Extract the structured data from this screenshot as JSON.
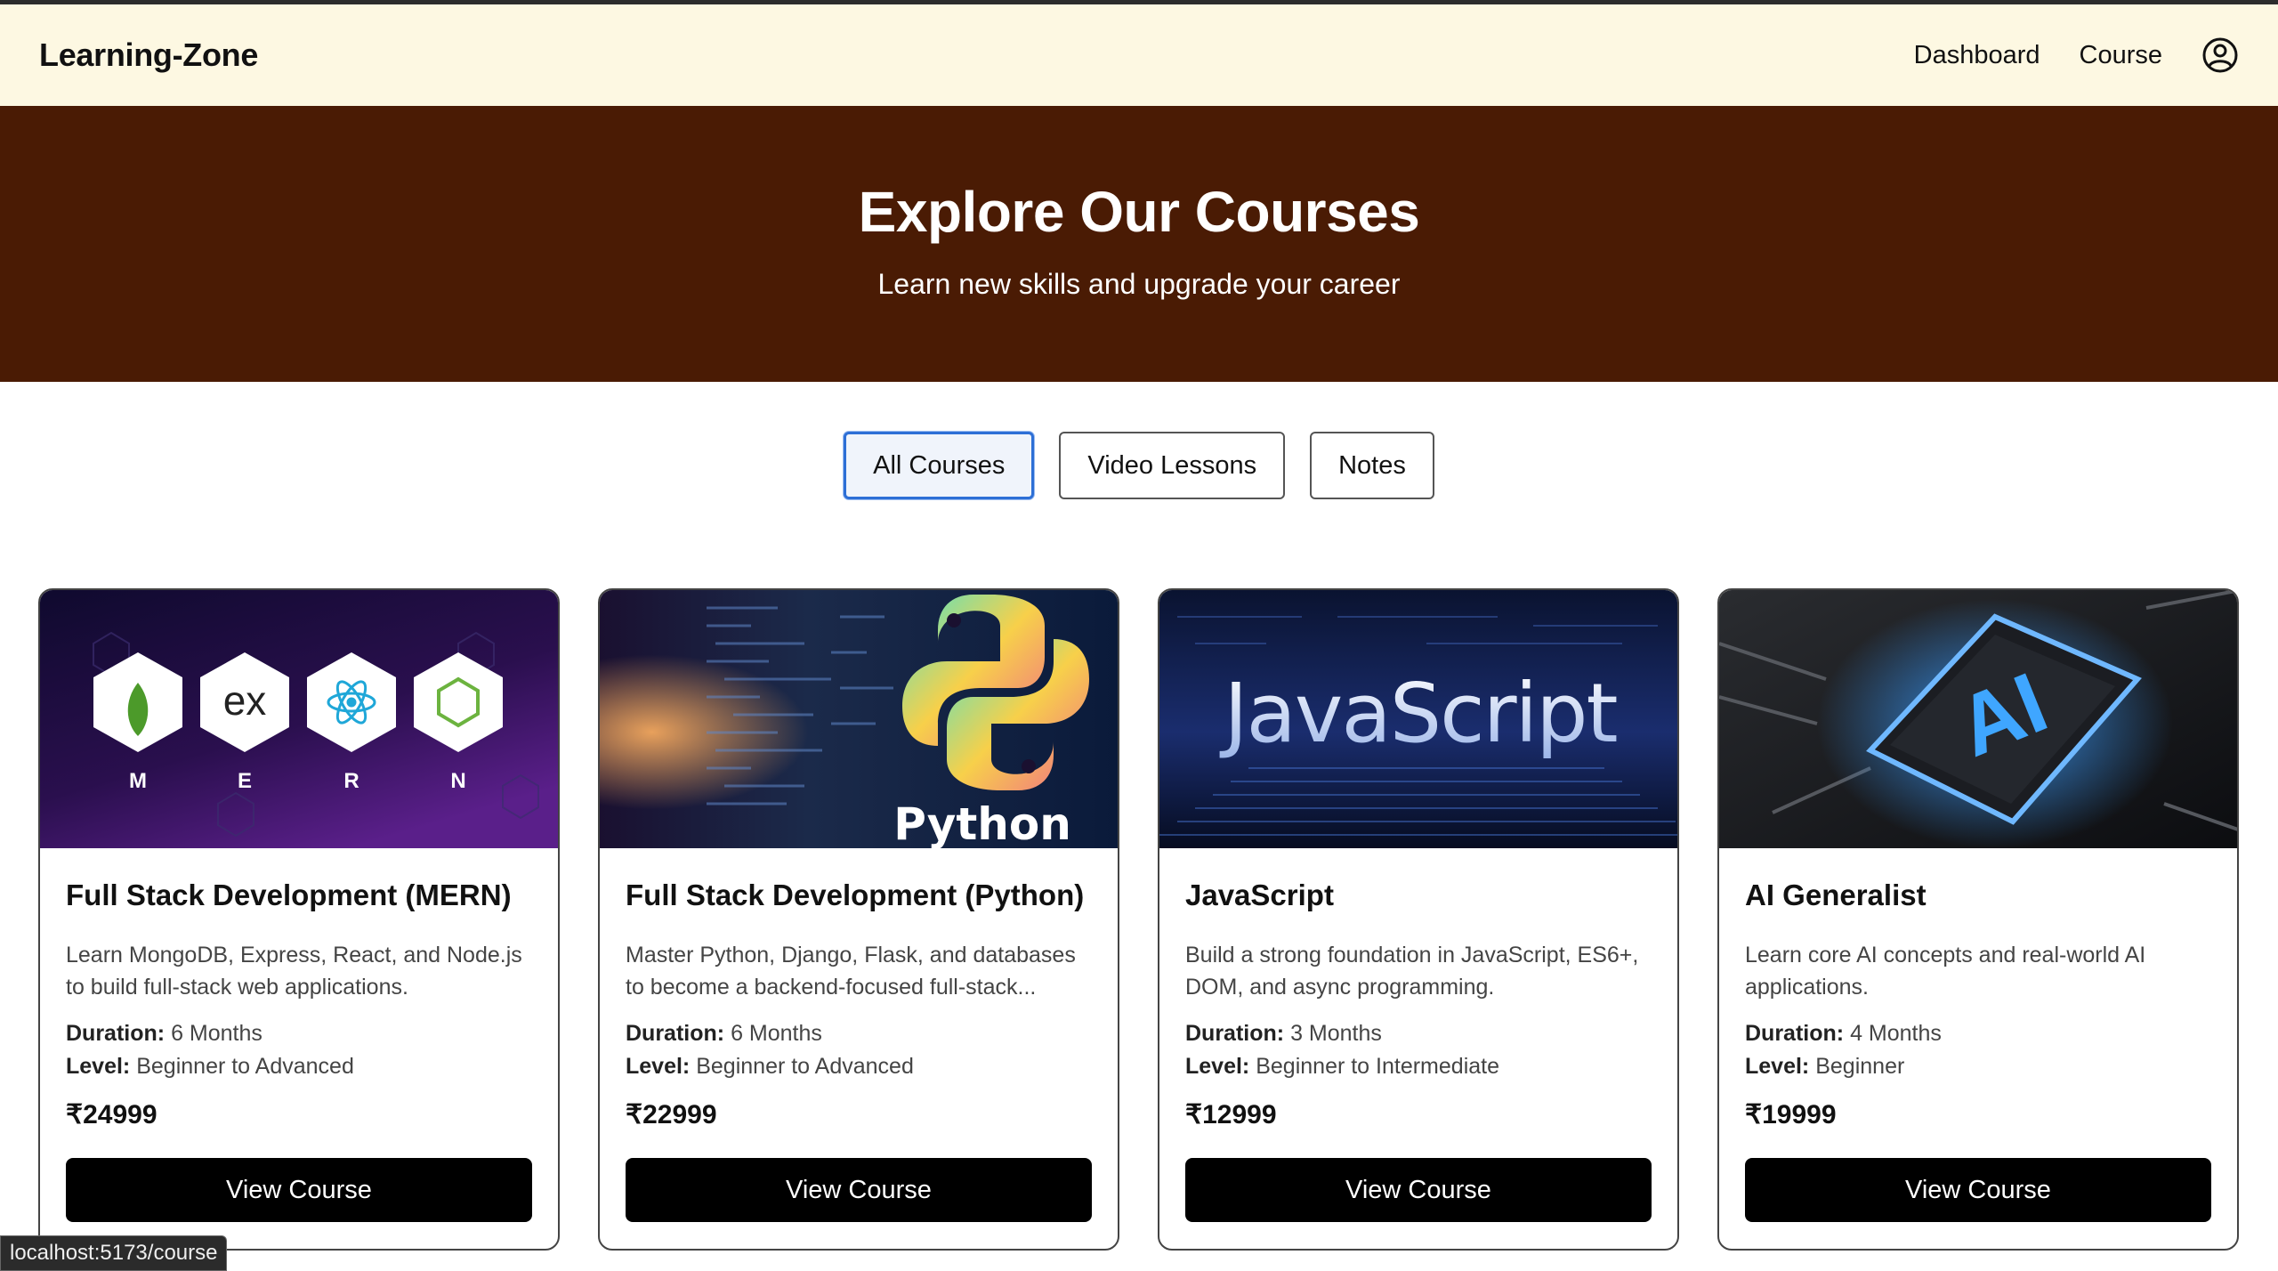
{
  "navbar": {
    "brand": "Learning-Zone",
    "links": [
      "Dashboard",
      "Course"
    ]
  },
  "hero": {
    "title": "Explore Our Courses",
    "subtitle": "Learn new skills and upgrade your career"
  },
  "filters": {
    "items": [
      "All Courses",
      "Video Lessons",
      "Notes"
    ],
    "active": "All Courses"
  },
  "cards": [
    {
      "image_text": {
        "letters": [
          "M",
          "E",
          "R",
          "N"
        ],
        "ex": "ex"
      },
      "title": "Full Stack Development (MERN)",
      "description": "Learn MongoDB, Express, React, and Node.js to build full-stack web applications.",
      "duration_label": "Duration:",
      "duration": "6 Months",
      "level_label": "Level:",
      "level": "Beginner to Advanced",
      "price": "₹24999",
      "button": "View Course"
    },
    {
      "image_text": {
        "word": "Python"
      },
      "title": "Full Stack Development (Python)",
      "description": "Master Python, Django, Flask, and databases to become a backend-focused full-stack...",
      "duration_label": "Duration:",
      "duration": "6 Months",
      "level_label": "Level:",
      "level": "Beginner to Advanced",
      "price": "₹22999",
      "button": "View Course"
    },
    {
      "image_text": {
        "word": "JavaScript"
      },
      "title": "JavaScript",
      "description": "Build a strong foundation in JavaScript, ES6+, DOM, and async programming.",
      "duration_label": "Duration:",
      "duration": "3 Months",
      "level_label": "Level:",
      "level": "Beginner to Intermediate",
      "price": "₹12999",
      "button": "View Course"
    },
    {
      "image_text": {
        "word": "AI"
      },
      "title": "AI Generalist",
      "description": "Learn core AI concepts and real-world AI applications.",
      "duration_label": "Duration:",
      "duration": "4 Months",
      "level_label": "Level:",
      "level": "Beginner",
      "price": "₹19999",
      "button": "View Course"
    }
  ],
  "status_bar": {
    "url": "localhost:5173/course"
  },
  "colors": {
    "navbar_bg": "#fdf8e2",
    "hero_bg": "#4a1b04",
    "active_filter_border": "#2d6fd6",
    "button_bg": "#000000"
  }
}
